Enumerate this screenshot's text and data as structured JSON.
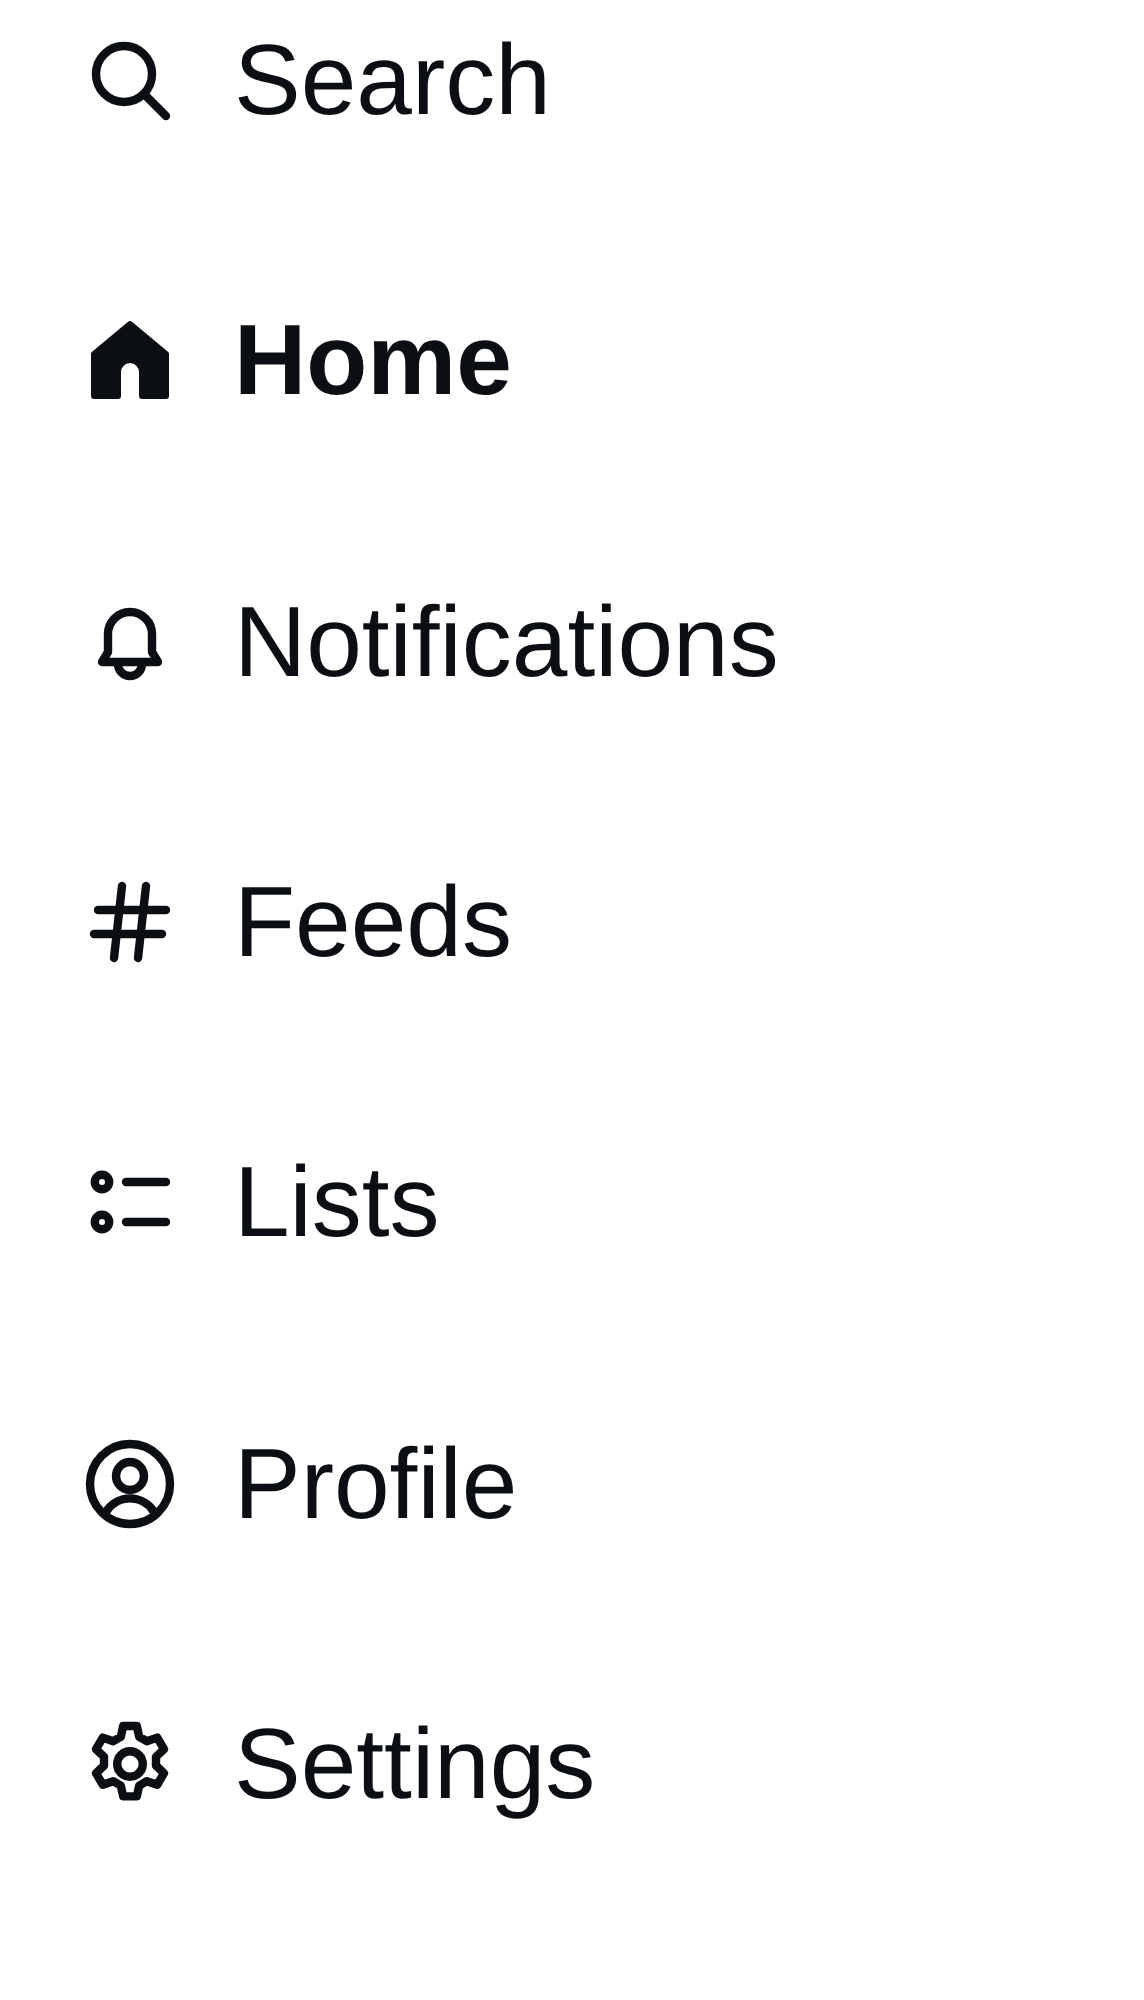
{
  "menu": [
    {
      "label": "Search",
      "selected": false
    },
    {
      "label": "Home",
      "selected": true
    },
    {
      "label": "Notifications",
      "selected": false
    },
    {
      "label": "Feeds",
      "selected": false
    },
    {
      "label": "Lists",
      "selected": false
    },
    {
      "label": "Profile",
      "selected": false
    },
    {
      "label": "Settings",
      "selected": false
    }
  ]
}
